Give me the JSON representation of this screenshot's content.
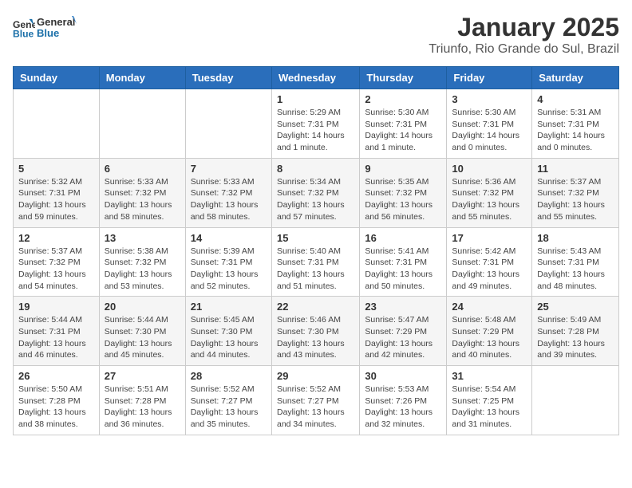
{
  "logo": {
    "line1": "General",
    "line2": "Blue"
  },
  "title": "January 2025",
  "subtitle": "Triunfo, Rio Grande do Sul, Brazil",
  "days_header": [
    "Sunday",
    "Monday",
    "Tuesday",
    "Wednesday",
    "Thursday",
    "Friday",
    "Saturday"
  ],
  "weeks": [
    [
      {
        "num": "",
        "info": ""
      },
      {
        "num": "",
        "info": ""
      },
      {
        "num": "",
        "info": ""
      },
      {
        "num": "1",
        "info": "Sunrise: 5:29 AM\nSunset: 7:31 PM\nDaylight: 14 hours\nand 1 minute."
      },
      {
        "num": "2",
        "info": "Sunrise: 5:30 AM\nSunset: 7:31 PM\nDaylight: 14 hours\nand 1 minute."
      },
      {
        "num": "3",
        "info": "Sunrise: 5:30 AM\nSunset: 7:31 PM\nDaylight: 14 hours\nand 0 minutes."
      },
      {
        "num": "4",
        "info": "Sunrise: 5:31 AM\nSunset: 7:31 PM\nDaylight: 14 hours\nand 0 minutes."
      }
    ],
    [
      {
        "num": "5",
        "info": "Sunrise: 5:32 AM\nSunset: 7:31 PM\nDaylight: 13 hours\nand 59 minutes."
      },
      {
        "num": "6",
        "info": "Sunrise: 5:33 AM\nSunset: 7:32 PM\nDaylight: 13 hours\nand 58 minutes."
      },
      {
        "num": "7",
        "info": "Sunrise: 5:33 AM\nSunset: 7:32 PM\nDaylight: 13 hours\nand 58 minutes."
      },
      {
        "num": "8",
        "info": "Sunrise: 5:34 AM\nSunset: 7:32 PM\nDaylight: 13 hours\nand 57 minutes."
      },
      {
        "num": "9",
        "info": "Sunrise: 5:35 AM\nSunset: 7:32 PM\nDaylight: 13 hours\nand 56 minutes."
      },
      {
        "num": "10",
        "info": "Sunrise: 5:36 AM\nSunset: 7:32 PM\nDaylight: 13 hours\nand 55 minutes."
      },
      {
        "num": "11",
        "info": "Sunrise: 5:37 AM\nSunset: 7:32 PM\nDaylight: 13 hours\nand 55 minutes."
      }
    ],
    [
      {
        "num": "12",
        "info": "Sunrise: 5:37 AM\nSunset: 7:32 PM\nDaylight: 13 hours\nand 54 minutes."
      },
      {
        "num": "13",
        "info": "Sunrise: 5:38 AM\nSunset: 7:32 PM\nDaylight: 13 hours\nand 53 minutes."
      },
      {
        "num": "14",
        "info": "Sunrise: 5:39 AM\nSunset: 7:31 PM\nDaylight: 13 hours\nand 52 minutes."
      },
      {
        "num": "15",
        "info": "Sunrise: 5:40 AM\nSunset: 7:31 PM\nDaylight: 13 hours\nand 51 minutes."
      },
      {
        "num": "16",
        "info": "Sunrise: 5:41 AM\nSunset: 7:31 PM\nDaylight: 13 hours\nand 50 minutes."
      },
      {
        "num": "17",
        "info": "Sunrise: 5:42 AM\nSunset: 7:31 PM\nDaylight: 13 hours\nand 49 minutes."
      },
      {
        "num": "18",
        "info": "Sunrise: 5:43 AM\nSunset: 7:31 PM\nDaylight: 13 hours\nand 48 minutes."
      }
    ],
    [
      {
        "num": "19",
        "info": "Sunrise: 5:44 AM\nSunset: 7:31 PM\nDaylight: 13 hours\nand 46 minutes."
      },
      {
        "num": "20",
        "info": "Sunrise: 5:44 AM\nSunset: 7:30 PM\nDaylight: 13 hours\nand 45 minutes."
      },
      {
        "num": "21",
        "info": "Sunrise: 5:45 AM\nSunset: 7:30 PM\nDaylight: 13 hours\nand 44 minutes."
      },
      {
        "num": "22",
        "info": "Sunrise: 5:46 AM\nSunset: 7:30 PM\nDaylight: 13 hours\nand 43 minutes."
      },
      {
        "num": "23",
        "info": "Sunrise: 5:47 AM\nSunset: 7:29 PM\nDaylight: 13 hours\nand 42 minutes."
      },
      {
        "num": "24",
        "info": "Sunrise: 5:48 AM\nSunset: 7:29 PM\nDaylight: 13 hours\nand 40 minutes."
      },
      {
        "num": "25",
        "info": "Sunrise: 5:49 AM\nSunset: 7:28 PM\nDaylight: 13 hours\nand 39 minutes."
      }
    ],
    [
      {
        "num": "26",
        "info": "Sunrise: 5:50 AM\nSunset: 7:28 PM\nDaylight: 13 hours\nand 38 minutes."
      },
      {
        "num": "27",
        "info": "Sunrise: 5:51 AM\nSunset: 7:28 PM\nDaylight: 13 hours\nand 36 minutes."
      },
      {
        "num": "28",
        "info": "Sunrise: 5:52 AM\nSunset: 7:27 PM\nDaylight: 13 hours\nand 35 minutes."
      },
      {
        "num": "29",
        "info": "Sunrise: 5:52 AM\nSunset: 7:27 PM\nDaylight: 13 hours\nand 34 minutes."
      },
      {
        "num": "30",
        "info": "Sunrise: 5:53 AM\nSunset: 7:26 PM\nDaylight: 13 hours\nand 32 minutes."
      },
      {
        "num": "31",
        "info": "Sunrise: 5:54 AM\nSunset: 7:25 PM\nDaylight: 13 hours\nand 31 minutes."
      },
      {
        "num": "",
        "info": ""
      }
    ]
  ]
}
